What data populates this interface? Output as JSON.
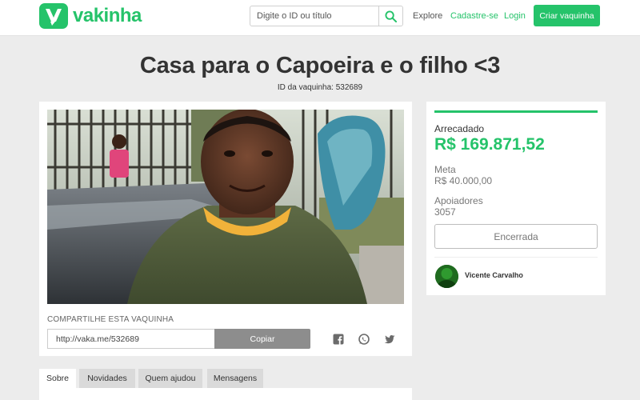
{
  "brand": {
    "name": "vakinha",
    "color": "#25c36a"
  },
  "header": {
    "search_placeholder": "Digite o ID ou título",
    "search_icon": "magnifier-icon",
    "nav": {
      "explore": "Explore",
      "signup": "Cadastre-se",
      "login": "Login"
    },
    "cta": "Criar vaquinha"
  },
  "campaign": {
    "title": "Casa para o Capoeira e o filho <3",
    "id_line": "ID da vaquinha: 532689",
    "photo_alt": "Foto da vaquinha"
  },
  "share": {
    "label": "COMPARTILHE ESTA VAQUINHA",
    "url": "http://vaka.me/532689",
    "copy_label": "Copiar",
    "icons": [
      "facebook-icon",
      "whatsapp-icon",
      "twitter-icon"
    ]
  },
  "stats": {
    "progress_fraction": 1.0,
    "raised_label": "Arrecadado",
    "raised_value": "R$ 169.871,52",
    "goal_label": "Meta",
    "goal_value": "R$ 40.000,00",
    "backers_label": "Apoiadores",
    "backers_value": "3057",
    "status_label": "Encerrada"
  },
  "owner": {
    "name": "Vicente Carvalho"
  },
  "tabs": [
    {
      "label": "Sobre",
      "active": true
    },
    {
      "label": "Novidades",
      "active": false
    },
    {
      "label": "Quem ajudou",
      "active": false
    },
    {
      "label": "Mensagens",
      "active": false
    }
  ]
}
